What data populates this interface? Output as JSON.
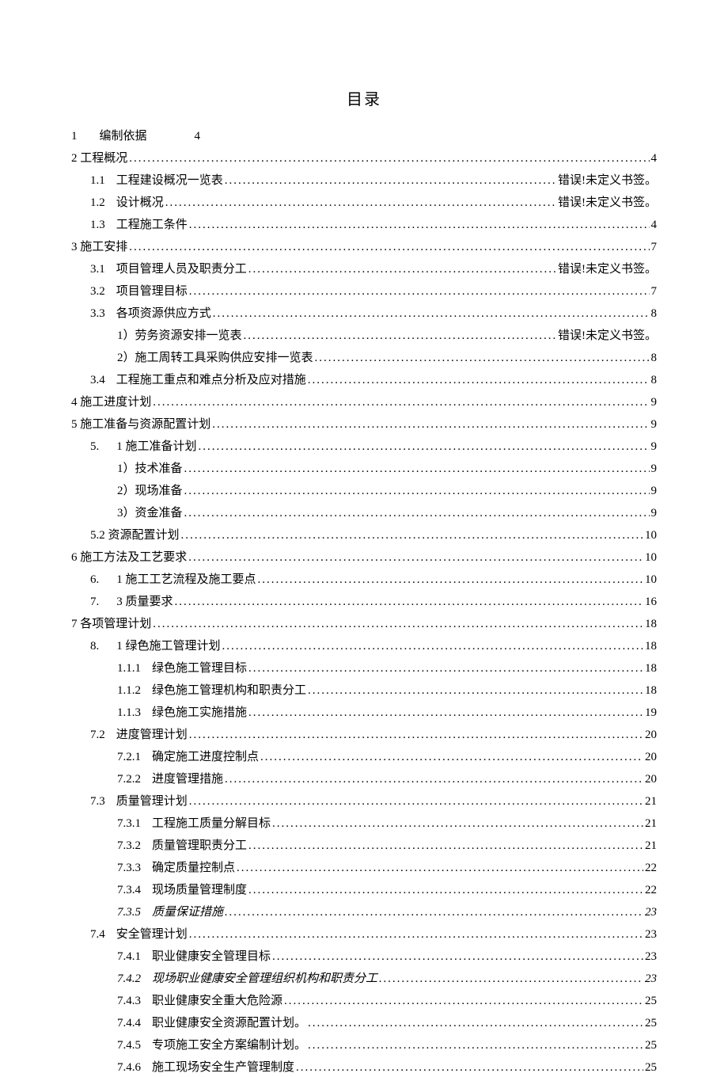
{
  "title": "目录",
  "dots": ".........................................................................................................................................................................................",
  "rows": [
    {
      "indent": 0,
      "label_parts": [
        "1",
        " ",
        "编制依据"
      ],
      "page": "4",
      "spacer_after_num": true,
      "no_leader": true,
      "page_gap": true
    },
    {
      "indent": 0,
      "label_parts": [
        "2 工程概况"
      ],
      "page": "4"
    },
    {
      "indent": 1,
      "label_parts": [
        "1.1",
        "工程建设概况一览表"
      ],
      "page": "错误!未定义书签。"
    },
    {
      "indent": 1,
      "label_parts": [
        "1.2",
        "设计概况"
      ],
      "page": "错误!未定义书签。"
    },
    {
      "indent": 1,
      "label_parts": [
        "1.3",
        "工程施工条件"
      ],
      "page": "4"
    },
    {
      "indent": 0,
      "label_parts": [
        "3 施工安排"
      ],
      "page": "7"
    },
    {
      "indent": 1,
      "label_parts": [
        "3.1",
        "项目管理人员及职责分工"
      ],
      "page": "错误!未定义书签。"
    },
    {
      "indent": 1,
      "label_parts": [
        "3.2",
        "项目管理目标"
      ],
      "page": "7"
    },
    {
      "indent": 1,
      "label_parts": [
        "3.3",
        "各项资源供应方式"
      ],
      "page": "8"
    },
    {
      "indent": 2,
      "label_parts": [
        "1）劳务资源安排一览表"
      ],
      "page": "错误!未定义书签。"
    },
    {
      "indent": 2,
      "label_parts": [
        "2）施工周转工具采购供应安排一览表"
      ],
      "page": "8"
    },
    {
      "indent": 1,
      "label_parts": [
        "3.4",
        "工程施工重点和难点分析及应对措施"
      ],
      "page": "8"
    },
    {
      "indent": 0,
      "label_parts": [
        "4 施工进度计划"
      ],
      "page": "9"
    },
    {
      "indent": 0,
      "label_parts": [
        "5 施工准备与资源配置计划"
      ],
      "page": "9"
    },
    {
      "indent": 1,
      "label_parts": [
        "5.",
        "1 施工准备计划"
      ],
      "page": "9",
      "num_split": true
    },
    {
      "indent": 2,
      "label_parts": [
        "1）技术准备"
      ],
      "page": "9"
    },
    {
      "indent": 2,
      "label_parts": [
        "2）现场准备"
      ],
      "page": "9"
    },
    {
      "indent": 2,
      "label_parts": [
        "3）资金准备"
      ],
      "page": "9"
    },
    {
      "indent": 1,
      "label_parts": [
        "5.2 资源配置计划"
      ],
      "page": "10"
    },
    {
      "indent": 0,
      "label_parts": [
        "6 施工方法及工艺要求"
      ],
      "page": "10"
    },
    {
      "indent": 1,
      "label_parts": [
        "6.",
        "1 施工工艺流程及施工要点"
      ],
      "page": "10",
      "num_split": true
    },
    {
      "indent": 1,
      "label_parts": [
        "7.",
        "3 质量要求"
      ],
      "page": "16",
      "num_split": true
    },
    {
      "indent": 0,
      "label_parts": [
        "7 各项管理计划"
      ],
      "page": "18"
    },
    {
      "indent": 1,
      "label_parts": [
        "8.",
        "1 绿色施工管理计划"
      ],
      "page": "18",
      "num_split": true
    },
    {
      "indent": 2,
      "label_parts": [
        "1.1.1",
        "绿色施工管理目标"
      ],
      "page": "18"
    },
    {
      "indent": 2,
      "label_parts": [
        "1.1.2",
        "绿色施工管理机构和职责分工"
      ],
      "page": "18"
    },
    {
      "indent": 2,
      "label_parts": [
        "1.1.3",
        "绿色施工实施措施"
      ],
      "page": "19"
    },
    {
      "indent": 1,
      "label_parts": [
        "7.2",
        "进度管理计划"
      ],
      "page": "20"
    },
    {
      "indent": 2,
      "label_parts": [
        "7.2.1",
        "确定施工进度控制点"
      ],
      "page": "20"
    },
    {
      "indent": 2,
      "label_parts": [
        "7.2.2",
        "进度管理措施"
      ],
      "page": "20"
    },
    {
      "indent": 1,
      "label_parts": [
        "7.3",
        "质量管理计划"
      ],
      "page": "21"
    },
    {
      "indent": 2,
      "label_parts": [
        "7.3.1",
        "工程施工质量分解目标"
      ],
      "page": "21"
    },
    {
      "indent": 2,
      "label_parts": [
        "7.3.2",
        "质量管理职责分工"
      ],
      "page": "21"
    },
    {
      "indent": 2,
      "label_parts": [
        "7.3.3",
        "确定质量控制点"
      ],
      "page": "22"
    },
    {
      "indent": 2,
      "label_parts": [
        "7.3.4",
        "现场质量管理制度"
      ],
      "page": "22"
    },
    {
      "indent": 2,
      "label_parts": [
        "7.3.5",
        "质量保证措施"
      ],
      "page": "23",
      "italic": true
    },
    {
      "indent": 1,
      "label_parts": [
        "7.4",
        "安全管理计划"
      ],
      "page": "23"
    },
    {
      "indent": 2,
      "label_parts": [
        "7.4.1",
        "职业健康安全管理目标"
      ],
      "page": "23"
    },
    {
      "indent": 2,
      "label_parts": [
        "7.4.2",
        "现场职业健康安全管理组织机构和职责分工"
      ],
      "page": "23",
      "italic": true
    },
    {
      "indent": 2,
      "label_parts": [
        "7.4.3",
        "职业健康安全重大危险源"
      ],
      "page": "25"
    },
    {
      "indent": 2,
      "label_parts": [
        "7.4.4",
        "职业健康安全资源配置计划。"
      ],
      "page": "25"
    },
    {
      "indent": 2,
      "label_parts": [
        "7.4.5",
        "专项施工安全方案编制计划。"
      ],
      "page": "25"
    },
    {
      "indent": 2,
      "label_parts": [
        "7.4.6",
        "施工现场安全生产管理制度"
      ],
      "page": "25"
    }
  ]
}
